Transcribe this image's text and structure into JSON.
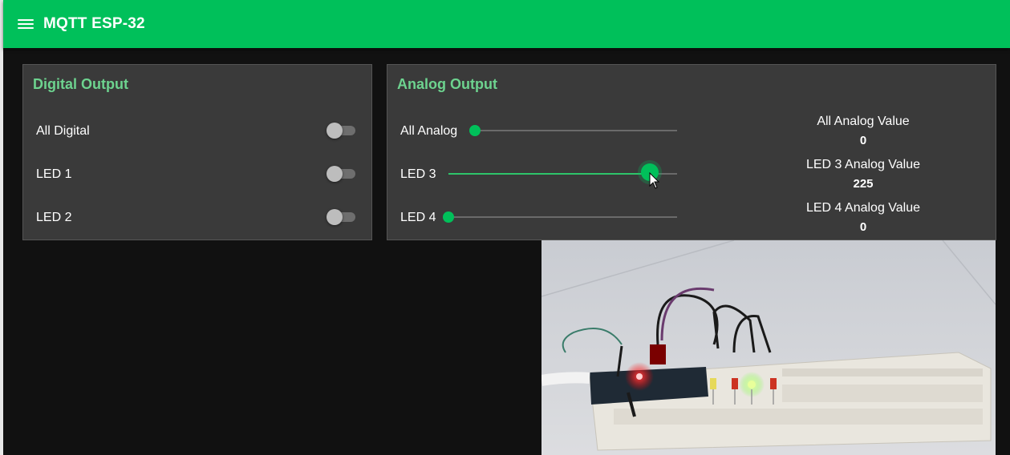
{
  "app_bar": {
    "title": "MQTT ESP-32",
    "menu_icon": "menu-icon",
    "color": "#00c05a"
  },
  "digital": {
    "title": "Digital Output",
    "rows": [
      {
        "label": "All Digital",
        "checked": false
      },
      {
        "label": "LED 1",
        "checked": false
      },
      {
        "label": "LED 2",
        "checked": false
      }
    ]
  },
  "analog": {
    "title": "Analog Output",
    "sliders": [
      {
        "label": "All Analog",
        "value": 0,
        "max": 255
      },
      {
        "label": "LED 3",
        "value": 225,
        "max": 255
      },
      {
        "label": "LED 4",
        "value": 0,
        "max": 255
      }
    ],
    "readouts": [
      {
        "label": "All Analog Value",
        "value": "0"
      },
      {
        "label": "LED 3 Analog Value",
        "value": "225"
      },
      {
        "label": "LED 4 Analog Value",
        "value": "0"
      }
    ]
  },
  "colors": {
    "accent": "#00c05a",
    "card_title": "#6dd38f",
    "card_bg": "#3a3a3a",
    "page_bg": "#111111"
  }
}
